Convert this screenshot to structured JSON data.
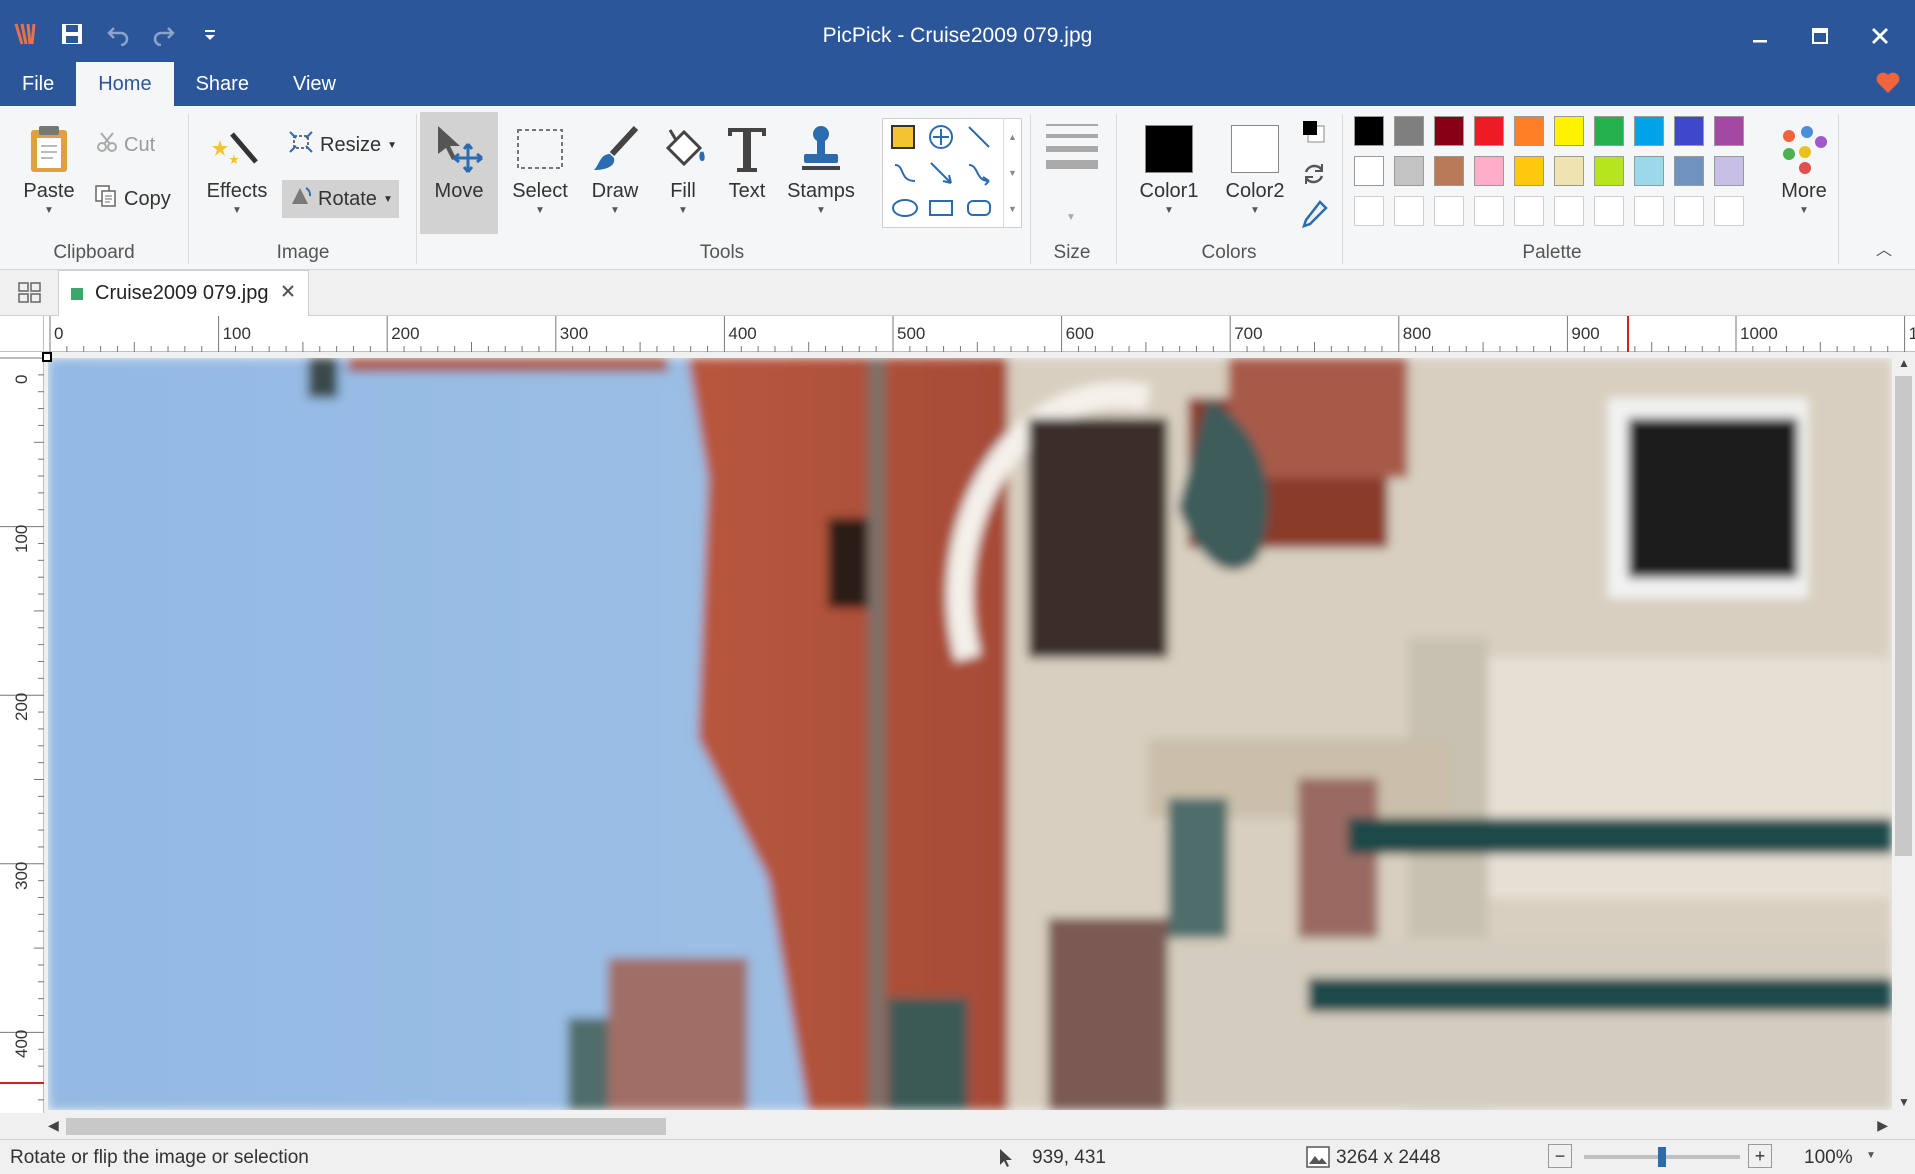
{
  "window": {
    "title": "PicPick - Cruise2009 079.jpg"
  },
  "ribbon_tabs": [
    "File",
    "Home",
    "Share",
    "View"
  ],
  "groups": {
    "clipboard": {
      "label": "Clipboard",
      "paste": "Paste",
      "cut": "Cut",
      "copy": "Copy"
    },
    "image": {
      "label": "Image",
      "effects": "Effects",
      "resize": "Resize",
      "rotate": "Rotate"
    },
    "tools": {
      "label": "Tools",
      "move": "Move",
      "select": "Select",
      "draw": "Draw",
      "fill": "Fill",
      "text": "Text",
      "stamps": "Stamps"
    },
    "size": {
      "label": "Size"
    },
    "colors": {
      "label": "Colors",
      "color1": "Color1",
      "color2": "Color2",
      "color1_value": "#000000",
      "color2_value": "#ffffff"
    },
    "palette": {
      "label": "Palette",
      "more": "More",
      "row1": [
        "#000000",
        "#7f7f7f",
        "#880015",
        "#ed1c24",
        "#ff7f27",
        "#fff200",
        "#22b14c",
        "#00a2e8",
        "#3f48cc",
        "#a349a4"
      ],
      "row2": [
        "#ffffff",
        "#c3c3c3",
        "#b97a57",
        "#ffaec9",
        "#ffc90e",
        "#efe4b0",
        "#b5e61d",
        "#99d9ea",
        "#7092be",
        "#c8bfe7"
      ],
      "row3": [
        "#ffffff",
        "#ffffff",
        "#ffffff",
        "#ffffff",
        "#ffffff",
        "#ffffff",
        "#ffffff",
        "#ffffff",
        "#ffffff",
        "#ffffff"
      ]
    }
  },
  "document_tab": {
    "name": "Cruise2009 079.jpg"
  },
  "ruler": {
    "h_labels": [
      "0",
      "100",
      "200",
      "300",
      "400",
      "500",
      "600",
      "700",
      "800",
      "900",
      "1000",
      "1"
    ],
    "v_labels": [
      "0",
      "100",
      "200",
      "300",
      "400"
    ]
  },
  "status": {
    "message": "Rotate or flip the image or selection",
    "cursor_pos": "939, 431",
    "image_size": "3264 x 2448",
    "zoom": "100%",
    "zoom_slider_fraction": 0.5
  },
  "accent": "#2b579a"
}
